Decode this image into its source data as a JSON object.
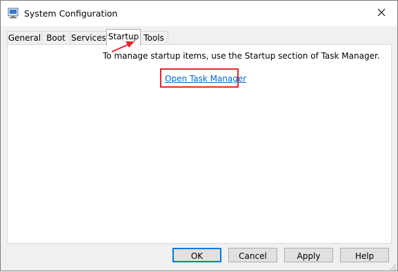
{
  "window": {
    "title": "System Configuration"
  },
  "tabs": [
    {
      "label": "General"
    },
    {
      "label": "Boot"
    },
    {
      "label": "Services"
    },
    {
      "label": "Startup"
    },
    {
      "label": "Tools"
    }
  ],
  "active_tab": "Startup",
  "startup_panel": {
    "info_text": "To manage startup items, use the Startup section of Task Manager.",
    "link_label": "Open Task Manager"
  },
  "buttons": {
    "ok": "OK",
    "cancel": "Cancel",
    "apply": "Apply",
    "help": "Help"
  },
  "annotation": {
    "color": "#e8242c"
  },
  "colors": {
    "link": "#0066cc",
    "default_button_border": "#0078d7"
  },
  "icons": {
    "app": "msconfig-icon",
    "close": "close-icon",
    "grip": "resize-grip-icon"
  }
}
